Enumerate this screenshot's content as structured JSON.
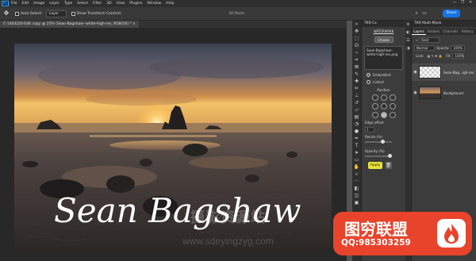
{
  "menubar": {
    "logo": "Ps",
    "items": [
      "File",
      "Edit",
      "Image",
      "Layer",
      "Type",
      "Select",
      "Filter",
      "3D",
      "View",
      "Plugins",
      "Window",
      "Help"
    ],
    "window_controls": [
      "—",
      "❐",
      "✕"
    ]
  },
  "options": {
    "auto_select_label": "Auto-Select:",
    "auto_select_value": "Layer",
    "transform_label": "Show Transform Controls",
    "mode3d_label": "3D Mode:",
    "share_label": "Share"
  },
  "document": {
    "tab_title": "C-1403220-Edit copy @ 25% (Sean-Bagshaw--white-high-res, RGB/16) * ×"
  },
  "watermark": {
    "signature_text": "Sean Bagshaw",
    "overlay_cn_text": "图穷联盟",
    "overlay_qq_text": "QQ:985303259",
    "site_text": "www.sdeyingzyg.com",
    "site_cn_text": "摄影资源站"
  },
  "tk9_panel": {
    "title": "TK9 Cx",
    "subtitle": "WATERMARK",
    "choose_label": "Choose",
    "filename": "Sean-Bagshaw--white-high-res.png",
    "embedded_label": "Embedded",
    "linked_label": "Linked",
    "position_label": "Position",
    "edge_offset_label": "Edge offset",
    "edge_offset_value": "1",
    "resize_label": "Resize (%)",
    "opacity_label": "Opacity (%)",
    "apply_label": "Apply"
  },
  "right_panel": {
    "title": "TK9 Multi-Mask",
    "tabs": [
      "Layers",
      "Actions",
      "Channels",
      "History"
    ],
    "kind_label": "Kind",
    "blend_mode": "Normal",
    "opacity_label": "Opacity:",
    "opacity_value": "100%",
    "lock_label": "Lock:",
    "fill_label": "Fill:",
    "fill_value": "100%",
    "layers": [
      {
        "name": "Sean-Bag...igh-res",
        "italic": false
      },
      {
        "name": "Background",
        "italic": true
      }
    ]
  }
}
